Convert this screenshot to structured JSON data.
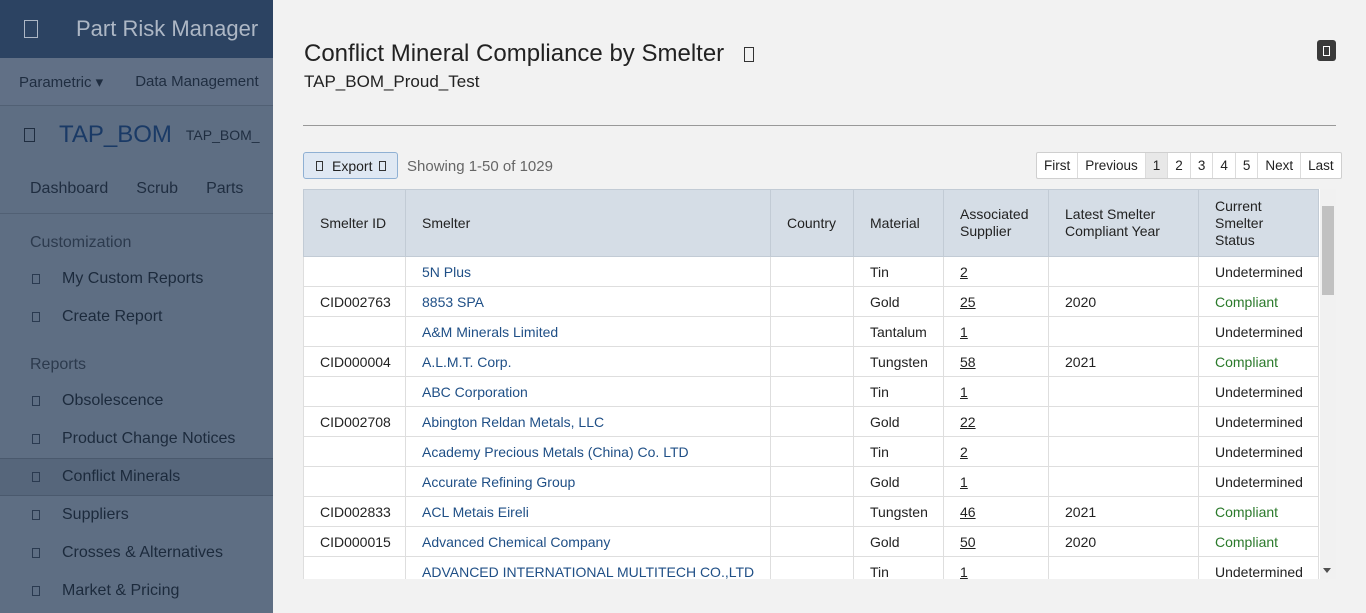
{
  "background": {
    "app_title": "Part Risk Manager",
    "menu": [
      "Parametric ▾",
      "Data Management"
    ],
    "bom_title": "TAP_BOM",
    "bom_sub": "TAP_BOM_",
    "tabs": [
      "Dashboard",
      "Scrub",
      "Parts"
    ],
    "sections": [
      {
        "title": "Customization",
        "items": [
          "My Custom Reports",
          "Create Report"
        ]
      },
      {
        "title": "Reports",
        "items": [
          "Obsolescence",
          "Product Change Notices",
          "Conflict Minerals",
          "Suppliers",
          "Crosses & Alternatives",
          "Market & Pricing"
        ]
      }
    ],
    "active_item": "Conflict Minerals"
  },
  "dialog": {
    "title": "Conflict Mineral Compliance by Smelter",
    "subtitle": "TAP_BOM_Proud_Test",
    "export_label": "Export",
    "showing": "Showing 1-50 of 1029",
    "pager": [
      "First",
      "Previous",
      "1",
      "2",
      "3",
      "4",
      "5",
      "Next",
      "Last"
    ],
    "current_page": "1",
    "columns": [
      "Smelter ID",
      "Smelter",
      "Country",
      "Material",
      "Associated Supplier",
      "Latest Smelter Compliant Year",
      "Current Smelter Status"
    ],
    "rows": [
      [
        "",
        "5N Plus",
        "",
        "Tin",
        "2",
        "",
        "Undetermined"
      ],
      [
        "CID002763",
        "8853 SPA",
        "",
        "Gold",
        "25",
        "2020",
        "Compliant"
      ],
      [
        "",
        "A&M Minerals Limited",
        "",
        "Tantalum",
        "1",
        "",
        "Undetermined"
      ],
      [
        "CID000004",
        "A.L.M.T. Corp.",
        "",
        "Tungsten",
        "58",
        "2021",
        "Compliant"
      ],
      [
        "",
        "ABC Corporation",
        "",
        "Tin",
        "1",
        "",
        "Undetermined"
      ],
      [
        "CID002708",
        "Abington Reldan Metals, LLC",
        "",
        "Gold",
        "22",
        "",
        "Undetermined"
      ],
      [
        "",
        "Academy Precious Metals (China) Co. LTD",
        "",
        "Tin",
        "2",
        "",
        "Undetermined"
      ],
      [
        "",
        "Accurate Refining Group",
        "",
        "Gold",
        "1",
        "",
        "Undetermined"
      ],
      [
        "CID002833",
        "ACL Metais Eireli",
        "",
        "Tungsten",
        "46",
        "2021",
        "Compliant"
      ],
      [
        "CID000015",
        "Advanced Chemical Company",
        "",
        "Gold",
        "50",
        "2020",
        "Compliant"
      ],
      [
        "",
        "ADVANCED INTERNATIONAL MULTITECH CO.,LTD",
        "",
        "Tin",
        "1",
        "",
        "Undetermined"
      ]
    ],
    "colors": {
      "link": "#1f4f86",
      "compliant": "#2b7a2b",
      "header_bg": "#d5dde6"
    }
  }
}
